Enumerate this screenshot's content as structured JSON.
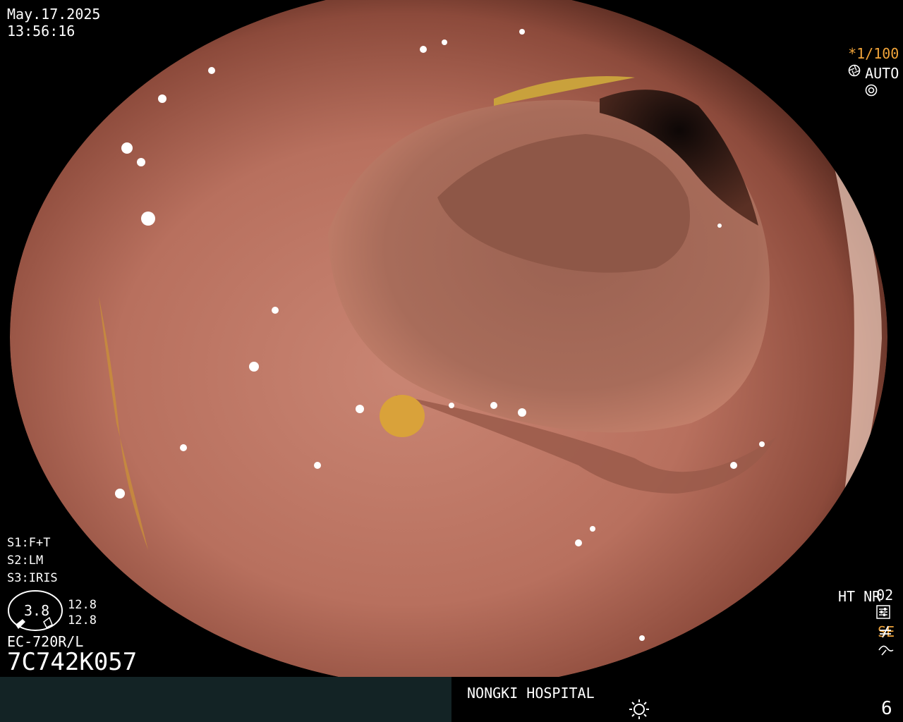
{
  "overlay": {
    "date": "May.17.2025",
    "time": "13:56:16",
    "shutter": "*1/100",
    "shutter_icon": "aperture-icon",
    "mode": "AUTO",
    "mode_icon": "iris-icon",
    "s1_label": "S1:",
    "s1_value": "F+T",
    "s2_label": "S2:",
    "s2_value": "LM",
    "s3_label": "S3:",
    "s3_value": "IRIS",
    "gauge_value": "3.8",
    "gauge_top": "12.8",
    "gauge_bottom": "12.8",
    "scope_model": "EC-720R/L",
    "scope_serial": "7C742K057",
    "right_code": "02",
    "right_code_icon": "settings-sliders-icon",
    "ht": "HT",
    "nr": "NR",
    "se": "SE",
    "se_icon": "curve-icon",
    "fn_icon": "not-equal-icon",
    "hospital": "NONGKI HOSPITAL",
    "brightness_icon": "sun-icon",
    "frame_number": "6"
  },
  "colors": {
    "orange_accent": "#f1a43a",
    "bottom_bar": "#132325",
    "mucosa": "#c57a66",
    "lumen": "#1a0e0c"
  }
}
